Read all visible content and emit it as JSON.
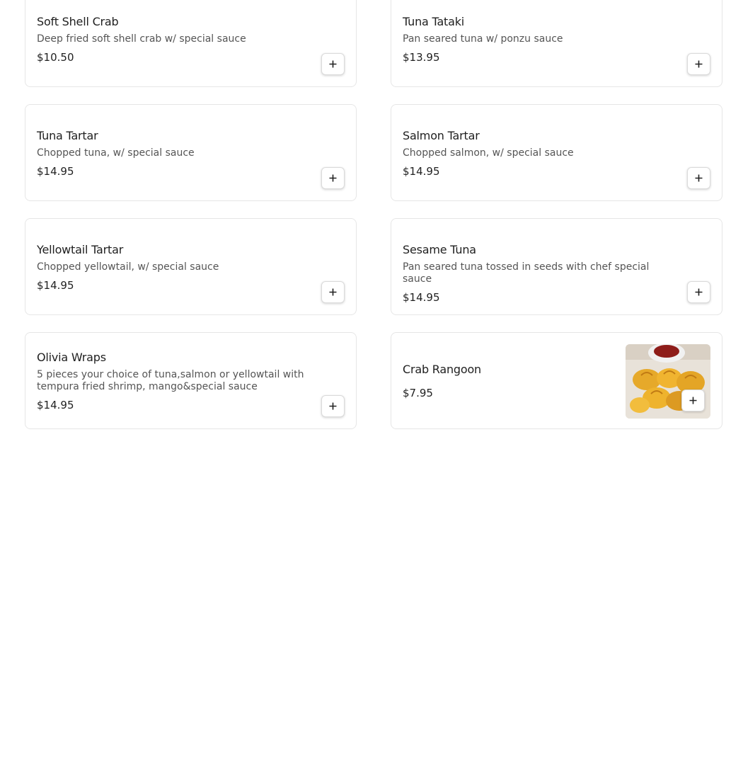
{
  "menu": {
    "items": [
      {
        "name": "Soft Shell Crab",
        "description": "Deep fried soft shell crab w/ special sauce",
        "price": "$10.50"
      },
      {
        "name": "Tuna Tataki",
        "description": "Pan seared tuna w/ ponzu sauce",
        "price": "$13.95"
      },
      {
        "name": "Tuna Tartar",
        "description": "Chopped tuna, w/ special sauce",
        "price": "$14.95"
      },
      {
        "name": "Salmon Tartar",
        "description": "Chopped salmon, w/ special sauce",
        "price": "$14.95"
      },
      {
        "name": "Yellowtail Tartar",
        "description": "Chopped yellowtail, w/ special sauce",
        "price": "$14.95"
      },
      {
        "name": "Sesame Tuna",
        "description": "Pan seared tuna tossed in seeds with chef special sauce",
        "price": "$14.95"
      },
      {
        "name": "Olivia Wraps",
        "description": "5 pieces your choice of tuna,salmon or yellowtail with tempura fried shrimp, mango&special sauce",
        "price": "$14.95"
      },
      {
        "name": "Crab Rangoon",
        "price": "$7.95",
        "image_icon": "food-photo"
      }
    ]
  },
  "colors": {
    "card_border": "#e6e6e6",
    "text_primary": "#1f1f1f",
    "text_secondary": "#555555"
  },
  "icons": {
    "add": "plus-icon"
  }
}
